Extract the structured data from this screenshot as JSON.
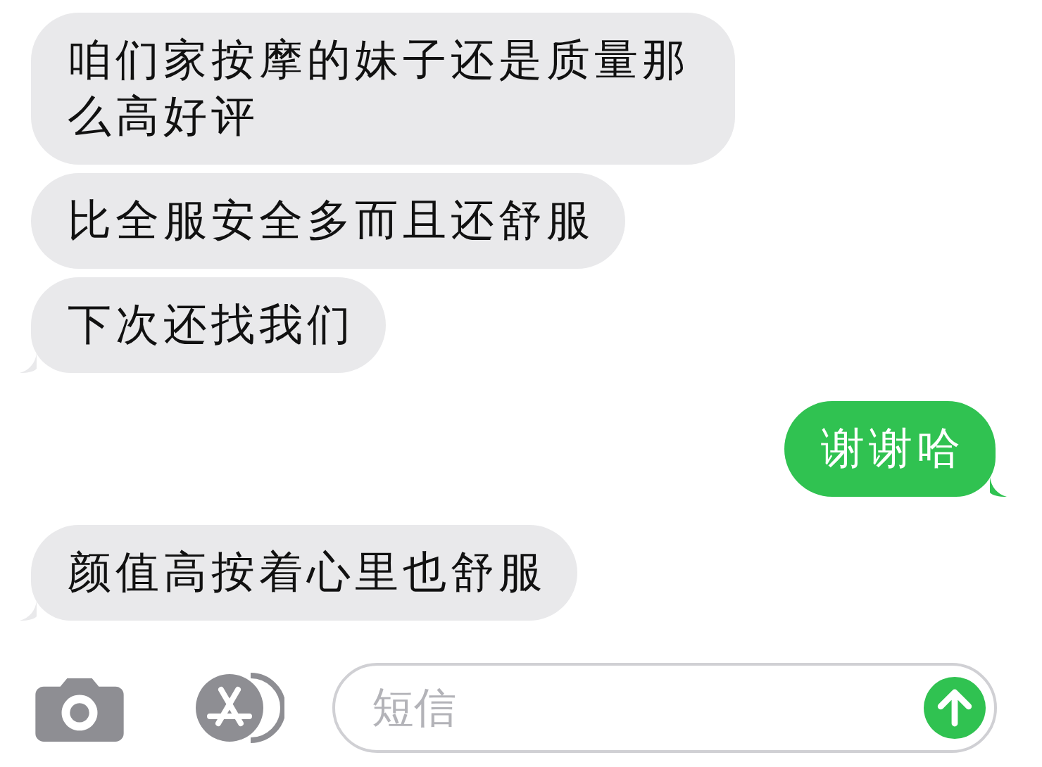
{
  "messages": [
    {
      "kind": "received",
      "text": "咱们家按摩的妹子还是质量那么高好评",
      "tail": false
    },
    {
      "kind": "received",
      "text": "比全服安全多而且还舒服",
      "tail": false
    },
    {
      "kind": "received",
      "text": "下次还找我们",
      "tail": true
    },
    {
      "kind": "sent",
      "text": "谢谢哈",
      "tail": true
    },
    {
      "kind": "received",
      "text": "颜值高按着心里也舒服",
      "tail": true
    }
  ],
  "composer": {
    "placeholder": "短信"
  }
}
